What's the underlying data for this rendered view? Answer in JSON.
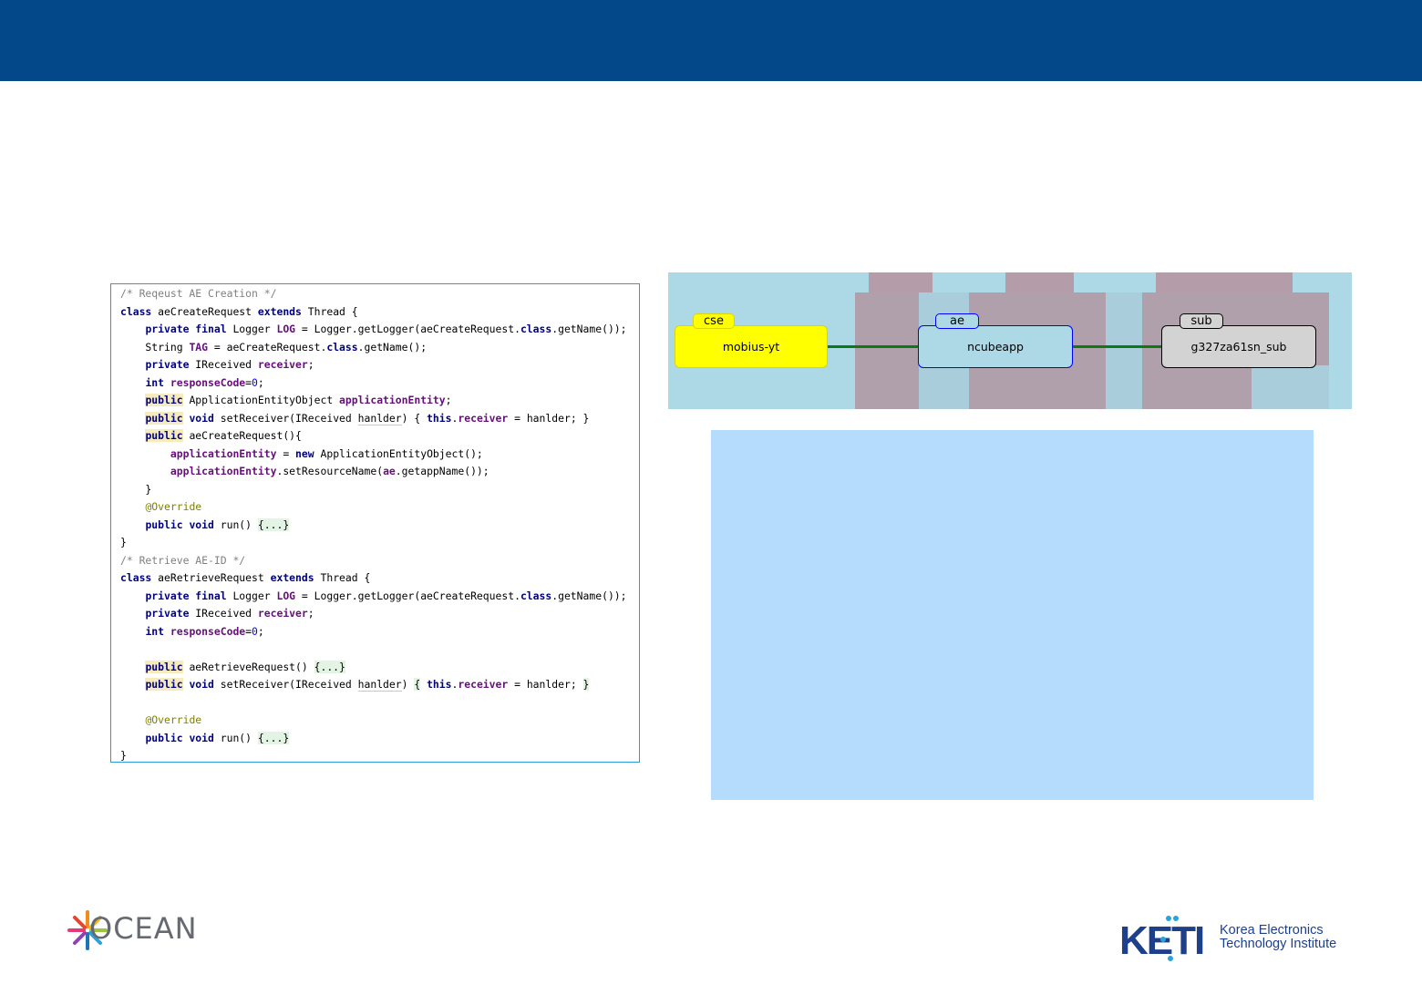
{
  "code_lines": [
    [
      [
        "/* Reqeust AE Creation */",
        "cmt"
      ]
    ],
    [
      [
        "class",
        "kw"
      ],
      [
        " aeCreateRequest ",
        ""
      ],
      [
        "extends",
        "kw"
      ],
      [
        " Thread {",
        ""
      ]
    ],
    [
      [
        "    ",
        ""
      ],
      [
        "private final",
        "kw"
      ],
      [
        " Logger ",
        ""
      ],
      [
        "LOG",
        "fld"
      ],
      [
        " = Logger.getLogger(aeCreateRequest.",
        ""
      ],
      [
        "class",
        "kw"
      ],
      [
        ".getName());",
        ""
      ]
    ],
    [
      [
        "    String ",
        ""
      ],
      [
        "TAG",
        "fld"
      ],
      [
        " = aeCreateRequest.",
        ""
      ],
      [
        "class",
        "kw"
      ],
      [
        ".getName();",
        ""
      ]
    ],
    [
      [
        "    ",
        ""
      ],
      [
        "private",
        "kw"
      ],
      [
        " IReceived ",
        ""
      ],
      [
        "receiver",
        "fld"
      ],
      [
        ";",
        ""
      ]
    ],
    [
      [
        "    ",
        ""
      ],
      [
        "int",
        "kw"
      ],
      [
        " ",
        ""
      ],
      [
        "responseCode",
        "fld"
      ],
      [
        "=",
        ""
      ],
      [
        "0",
        "num"
      ],
      [
        ";",
        ""
      ]
    ],
    [
      [
        "    ",
        ""
      ],
      [
        "public",
        "kw hl-y"
      ],
      [
        " ApplicationEntityObject ",
        ""
      ],
      [
        "applicationEntity",
        "fld"
      ],
      [
        ";",
        ""
      ]
    ],
    [
      [
        "    ",
        ""
      ],
      [
        "public",
        "kw hl-y"
      ],
      [
        " ",
        ""
      ],
      [
        "void",
        "kw"
      ],
      [
        " setReceiver(IReceived ",
        ""
      ],
      [
        "hanlder",
        "ul"
      ],
      [
        ") { ",
        ""
      ],
      [
        "this",
        "kw"
      ],
      [
        ".",
        ""
      ],
      [
        "receiver",
        "fld"
      ],
      [
        " = hanlder; }",
        ""
      ]
    ],
    [
      [
        "    ",
        ""
      ],
      [
        "public",
        "kw hl-y"
      ],
      [
        " aeCreateRequest(){",
        ""
      ]
    ],
    [
      [
        "        ",
        ""
      ],
      [
        "applicationEntity",
        "fld"
      ],
      [
        " = ",
        ""
      ],
      [
        "new",
        "kw"
      ],
      [
        " ApplicationEntityObject();",
        ""
      ]
    ],
    [
      [
        "        ",
        ""
      ],
      [
        "applicationEntity",
        "fld"
      ],
      [
        ".setResourceName(",
        ""
      ],
      [
        "ae",
        "fld"
      ],
      [
        ".getappName());",
        ""
      ]
    ],
    [
      [
        "    }",
        ""
      ]
    ],
    [
      [
        "    ",
        ""
      ],
      [
        "@Override",
        "ann"
      ]
    ],
    [
      [
        "    ",
        ""
      ],
      [
        "public void",
        "kw"
      ],
      [
        " run() ",
        ""
      ],
      [
        "{...}",
        "hl-g"
      ]
    ],
    [
      [
        "}",
        ""
      ]
    ],
    [
      [
        "/* Retrieve AE-ID */",
        "cmt"
      ]
    ],
    [
      [
        "class",
        "kw"
      ],
      [
        " aeRetrieveRequest ",
        ""
      ],
      [
        "extends",
        "kw"
      ],
      [
        " Thread {",
        ""
      ]
    ],
    [
      [
        "    ",
        ""
      ],
      [
        "private final",
        "kw"
      ],
      [
        " Logger ",
        ""
      ],
      [
        "LOG",
        "fld"
      ],
      [
        " = Logger.getLogger(aeCreateRequest.",
        ""
      ],
      [
        "class",
        "kw"
      ],
      [
        ".getName());",
        ""
      ]
    ],
    [
      [
        "    ",
        ""
      ],
      [
        "private",
        "kw"
      ],
      [
        " IReceived ",
        ""
      ],
      [
        "receiver",
        "fld"
      ],
      [
        ";",
        ""
      ]
    ],
    [
      [
        "    ",
        ""
      ],
      [
        "int",
        "kw"
      ],
      [
        " ",
        ""
      ],
      [
        "responseCode",
        "fld"
      ],
      [
        "=",
        ""
      ],
      [
        "0",
        "num"
      ],
      [
        ";",
        ""
      ]
    ],
    [
      [
        "",
        ""
      ]
    ],
    [
      [
        "    ",
        ""
      ],
      [
        "public",
        "kw hl-y"
      ],
      [
        " aeRetrieveRequest() ",
        ""
      ],
      [
        "{...}",
        "hl-g"
      ]
    ],
    [
      [
        "    ",
        ""
      ],
      [
        "public",
        "kw hl-y"
      ],
      [
        " ",
        ""
      ],
      [
        "void",
        "kw"
      ],
      [
        " setReceiver(IReceived ",
        ""
      ],
      [
        "hanlder",
        "ul"
      ],
      [
        ") ",
        ""
      ],
      [
        "{",
        "hl-g"
      ],
      [
        " ",
        ""
      ],
      [
        "this",
        "kw"
      ],
      [
        ".",
        ""
      ],
      [
        "receiver",
        "fld"
      ],
      [
        " = hanlder; ",
        ""
      ],
      [
        "}",
        "hl-g"
      ]
    ],
    [
      [
        "",
        ""
      ]
    ],
    [
      [
        "    ",
        ""
      ],
      [
        "@Override",
        "ann"
      ]
    ],
    [
      [
        "    ",
        ""
      ],
      [
        "public void",
        "kw"
      ],
      [
        " run() ",
        ""
      ],
      [
        "{...}",
        "hl-g"
      ]
    ],
    [
      [
        "}",
        ""
      ]
    ]
  ],
  "diagram": {
    "nodes": [
      {
        "tag": "cse",
        "label": "mobius-yt",
        "fill": "#ffff00",
        "stroke": "#d8d800"
      },
      {
        "tag": "ae",
        "label": "ncubeapp",
        "fill": "#add8e6",
        "stroke": "#0000ff"
      },
      {
        "tag": "sub",
        "label": "g327za61sn_sub",
        "fill": "#d3d3d3",
        "stroke": "#000000"
      }
    ],
    "link_color": "#0b7a12"
  },
  "logos": {
    "ocean": "OCEAN",
    "keti_mark": "KETI",
    "keti_line1": "Korea Electronics",
    "keti_line2": "Technology Institute"
  },
  "colors": {
    "header": "#034889",
    "code_border": "#2a9ad8",
    "diagram_bg": "#add8e6",
    "panel_blue": "#b5dcfd"
  }
}
